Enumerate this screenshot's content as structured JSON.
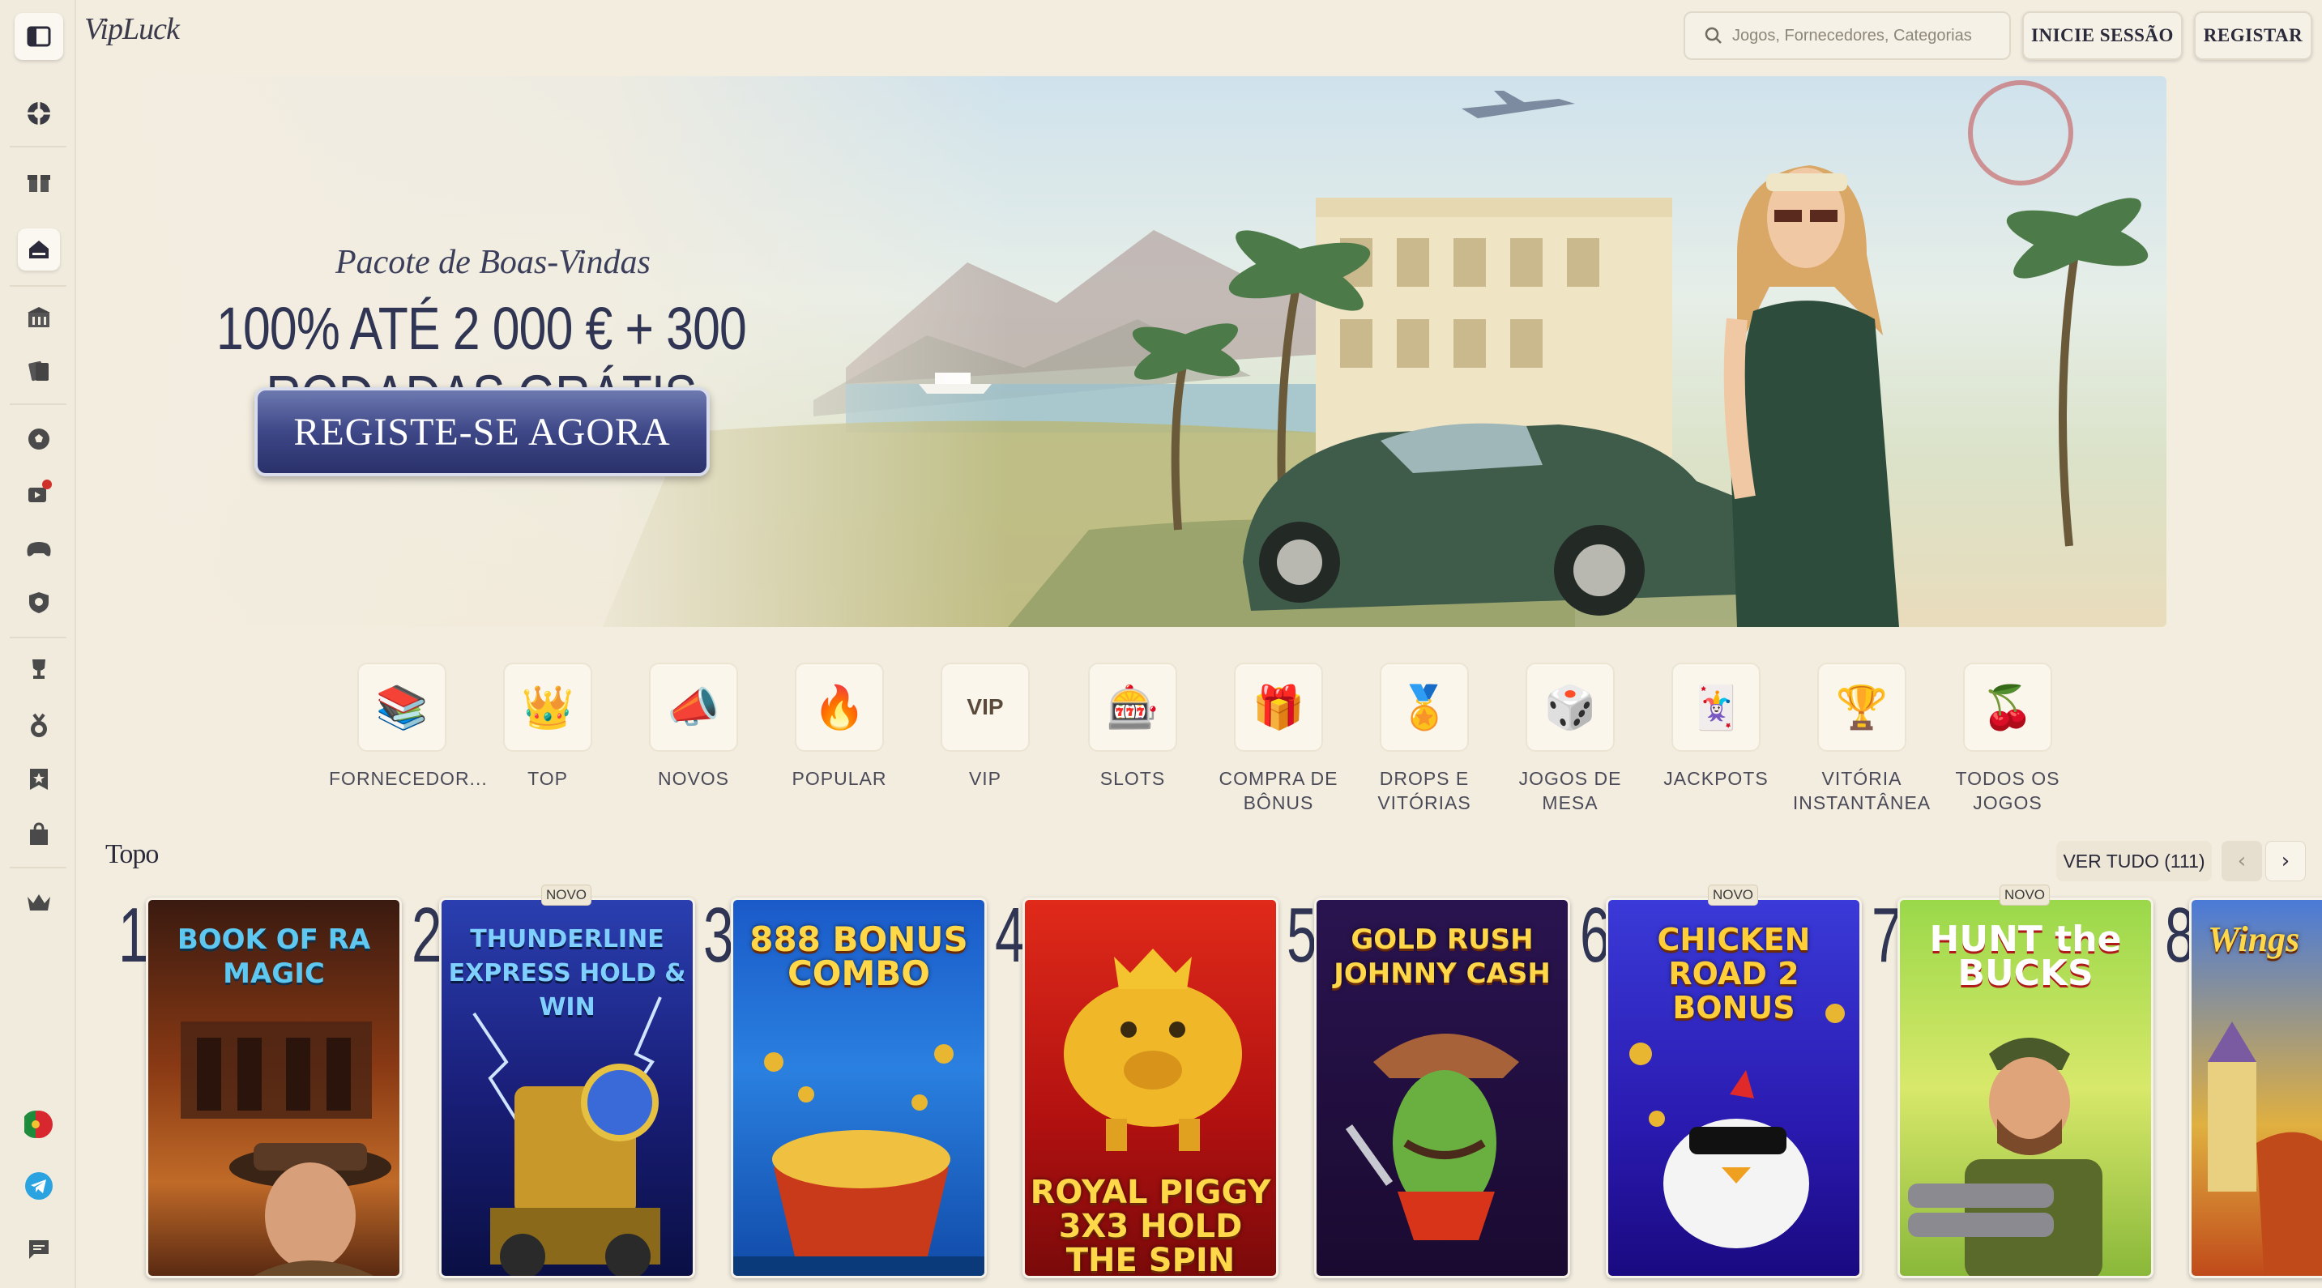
{
  "brand": {
    "logo": "VipLuck"
  },
  "header": {
    "search_placeholder": "Jogos, Fornecedores, Categorias",
    "login_label": "INICIE SESSÃO",
    "register_label": "REGISTAR"
  },
  "sidebar": {
    "icons": [
      "toggle-sidebar-icon",
      "globe-icon",
      "gift-icon",
      "home-icon",
      "casino-icon",
      "cards-icon",
      "sports-ball-icon",
      "live-tv-icon",
      "gamepad-icon",
      "shield-icon",
      "trophy-icon",
      "medal-icon",
      "star-bookmark-icon",
      "shopping-bag-icon",
      "crown-icon",
      "portugal-flag-icon",
      "telegram-icon",
      "chat-icon"
    ]
  },
  "hero": {
    "subtitle": "Pacote de Boas-Vindas",
    "title_line1": "100% ATÉ 2 000 € + 300",
    "title_line2": "RODADAS GRÁTIS",
    "cta": "REGISTE-SE AGORA"
  },
  "categories": [
    {
      "label_1": "FORNECEDOR...",
      "label_2": "",
      "icon": "📚"
    },
    {
      "label_1": "TOP",
      "label_2": "",
      "icon": "👑"
    },
    {
      "label_1": "NOVOS",
      "label_2": "",
      "icon": "📣"
    },
    {
      "label_1": "POPULAR",
      "label_2": "",
      "icon": "🔥"
    },
    {
      "label_1": "VIP",
      "label_2": "",
      "icon": "VIP"
    },
    {
      "label_1": "SLOTS",
      "label_2": "",
      "icon": "🎰"
    },
    {
      "label_1": "COMPRA DE",
      "label_2": "BÔNUS",
      "icon": "🎁"
    },
    {
      "label_1": "DROPS E",
      "label_2": "VITÓRIAS",
      "icon": "🏅"
    },
    {
      "label_1": "JOGOS DE",
      "label_2": "MESA",
      "icon": "🎲"
    },
    {
      "label_1": "JACKPOTS",
      "label_2": "",
      "icon": "🃏"
    },
    {
      "label_1": "VITÓRIA",
      "label_2": "INSTANTÂNEA",
      "icon": "🏆"
    },
    {
      "label_1": "TODOS OS",
      "label_2": "JOGOS",
      "icon": "🍒"
    }
  ],
  "top_section": {
    "title": "Topo",
    "view_all": "VER TUDO (111)",
    "prev": "‹",
    "next": "›",
    "badge_new": "NOVO",
    "games": [
      {
        "rank": "1",
        "title": "BOOK OF RA MAGIC",
        "new": false
      },
      {
        "rank": "2",
        "title": "THUNDERLINE EXPRESS HOLD & WIN",
        "new": true
      },
      {
        "rank": "3",
        "title": "888 BONUS COMBO",
        "new": false
      },
      {
        "rank": "4",
        "title": "ROYAL PIGGY 3X3 HOLD THE SPIN",
        "new": false
      },
      {
        "rank": "5",
        "title": "GOLD RUSH JOHNNY CASH",
        "new": false
      },
      {
        "rank": "6",
        "title": "CHICKEN ROAD 2 BONUS",
        "new": true
      },
      {
        "rank": "7",
        "title": "HUNT the BUCKS",
        "new": true
      },
      {
        "rank": "8",
        "title": "Wings",
        "new": false
      }
    ]
  }
}
